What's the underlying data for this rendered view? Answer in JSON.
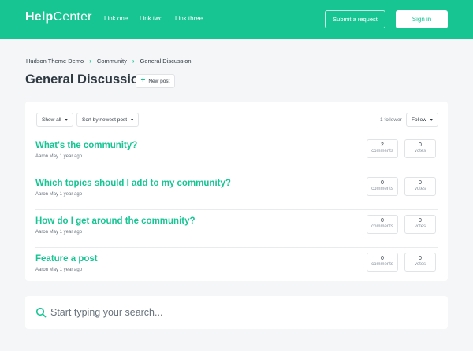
{
  "header": {
    "logo_bold": "Help",
    "logo_light": "Center",
    "links": [
      "Link one",
      "Link two",
      "Link three"
    ],
    "submit_label": "Submit a request",
    "signin_label": "Sign in"
  },
  "breadcrumb": [
    "Hudson Theme Demo",
    "Community",
    "General Discussion"
  ],
  "page": {
    "title": "General Discussion",
    "new_post_label": "New post"
  },
  "filters": {
    "show_label": "Show all",
    "sort_label": "Sort by newest post",
    "followers": "1 follower",
    "follow_label": "Follow"
  },
  "posts": [
    {
      "title": "What's the community?",
      "meta": "Aaron May 1 year ago",
      "comments": "2",
      "votes": "0"
    },
    {
      "title": "Which topics should I add to my community?",
      "meta": "Aaron May 1 year ago",
      "comments": "0",
      "votes": "0"
    },
    {
      "title": "How do I get around the community?",
      "meta": "Aaron May 1 year ago",
      "comments": "0",
      "votes": "0"
    },
    {
      "title": "Feature a post",
      "meta": "Aaron May 1 year ago",
      "comments": "0",
      "votes": "0"
    }
  ],
  "stat_labels": {
    "comments": "comments",
    "votes": "votes"
  },
  "search": {
    "placeholder": "Start typing your search..."
  },
  "colors": {
    "brand": "#17c593",
    "text": "#2f3941",
    "background": "#f4f6f8"
  }
}
